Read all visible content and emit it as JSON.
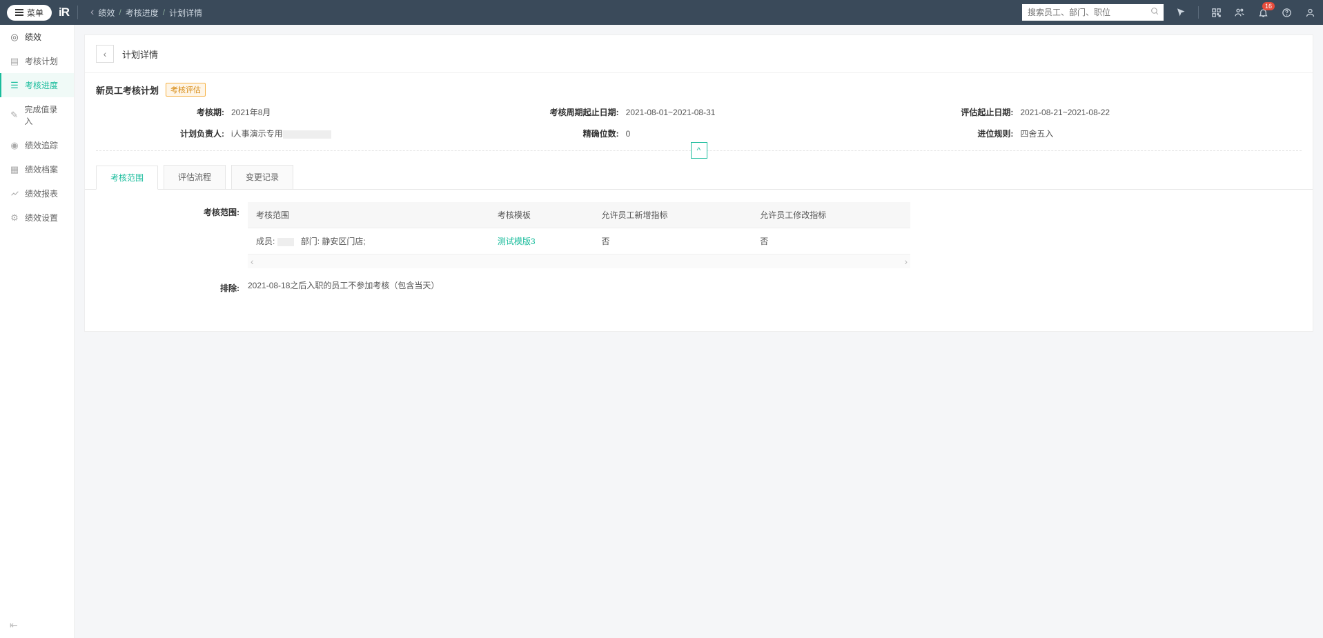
{
  "header": {
    "menu_label": "菜单",
    "logo_text": "iR",
    "breadcrumb": [
      "绩效",
      "考核进度",
      "计划详情"
    ],
    "search_placeholder": "搜索员工、部门、职位",
    "notification_count": "16"
  },
  "sidebar": {
    "items": [
      {
        "label": "绩效",
        "icon": "target-icon",
        "top": true
      },
      {
        "label": "考核计划",
        "icon": "plan-icon"
      },
      {
        "label": "考核进度",
        "icon": "progress-icon",
        "active": true
      },
      {
        "label": "完成值录入",
        "icon": "edit-icon"
      },
      {
        "label": "绩效追踪",
        "icon": "track-icon"
      },
      {
        "label": "绩效档案",
        "icon": "archive-icon"
      },
      {
        "label": "绩效报表",
        "icon": "report-icon"
      },
      {
        "label": "绩效设置",
        "icon": "settings-icon"
      }
    ]
  },
  "page": {
    "title": "计划详情",
    "plan_name": "新员工考核计划",
    "status": "考核评估",
    "info": {
      "period_label": "考核期:",
      "period_value": "2021年8月",
      "cycle_label": "考核周期起止日期:",
      "cycle_value": "2021-08-01~2021-08-31",
      "eval_label": "评估起止日期:",
      "eval_value": "2021-08-21~2021-08-22",
      "owner_label": "计划负责人:",
      "owner_value": "i人事演示专用",
      "precision_label": "精确位数:",
      "precision_value": "0",
      "rounding_label": "进位规则:",
      "rounding_value": "四舍五入"
    },
    "tabs": [
      "考核范围",
      "评估流程",
      "变更记录"
    ],
    "scope": {
      "label": "考核范围:",
      "headers": [
        "考核范围",
        "考核模板",
        "允许员工新增指标",
        "允许员工修改指标"
      ],
      "row": {
        "members_prefix": "成员:",
        "dept_prefix": "部门:",
        "dept_value": "静安区门店;",
        "template": "测试模版3",
        "allow_add": "否",
        "allow_modify": "否"
      }
    },
    "exclude": {
      "label": "排除:",
      "text": "2021-08-18之后入职的员工不参加考核（包含当天）"
    }
  }
}
